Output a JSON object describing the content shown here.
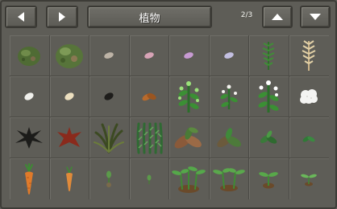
{
  "header": {
    "prev_icon": "triangle-left-icon",
    "next_icon": "triangle-right-icon",
    "category_title": "植物",
    "page_indicator": "2/3",
    "up_icon": "triangle-up-icon",
    "down_icon": "triangle-down-icon"
  },
  "grid": {
    "rows": [
      [
        "moss-boulder",
        "moss-boulder-large",
        "seed-pale",
        "seed-pink",
        "seed-violet",
        "seed-lavender",
        "fern-sprig",
        "wheat-sprig"
      ],
      [
        "seed-white",
        "seed-cream",
        "seed-black",
        "dried-leaves",
        "flowering-bush",
        "small-flowering-shrub",
        "white-flowering-bush",
        "cotton-ball"
      ],
      [
        "black-star-plant",
        "red-star-plant",
        "wild-grass-clump",
        "tall-grass-clump",
        "brown-leaf-sprout",
        "green-leaf-sprout",
        "small-leaf-sprout",
        "tiny-sprout"
      ],
      [
        "carrot",
        "carrot-small",
        "shoot",
        "shoot-tiny",
        "seedling-cluster",
        "seedling-pair",
        "seedling-small",
        "seedling-tiny"
      ]
    ]
  },
  "colors": {
    "panel": "#5e5d57",
    "grid_line": "#4a4944",
    "button": "#66655f"
  }
}
